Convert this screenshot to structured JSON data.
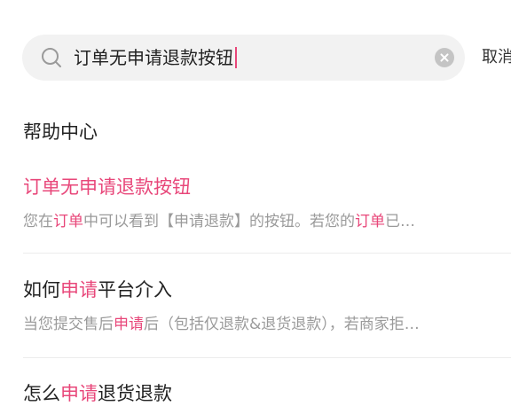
{
  "search": {
    "query": "订单无申请退款按钮",
    "cancel_label": "取消"
  },
  "section": {
    "title": "帮助中心"
  },
  "results": [
    {
      "title_parts": [
        "订单无申请退款按钮"
      ],
      "snippet_parts": [
        "您在",
        "订单",
        "中可以看到【申请退款】的按钮。若您的",
        "订单",
        "已…"
      ]
    },
    {
      "title_parts": [
        "如何",
        "申请",
        "平台介入"
      ],
      "snippet_parts": [
        "当您提交售后",
        "申请",
        "后（包括仅退款&退货退款），若商家拒…"
      ]
    },
    {
      "title_parts": [
        "怎么",
        "申请",
        "退货退款"
      ]
    }
  ],
  "colors": {
    "highlight": "#e8477a",
    "search_bg": "#f2f2f2"
  }
}
